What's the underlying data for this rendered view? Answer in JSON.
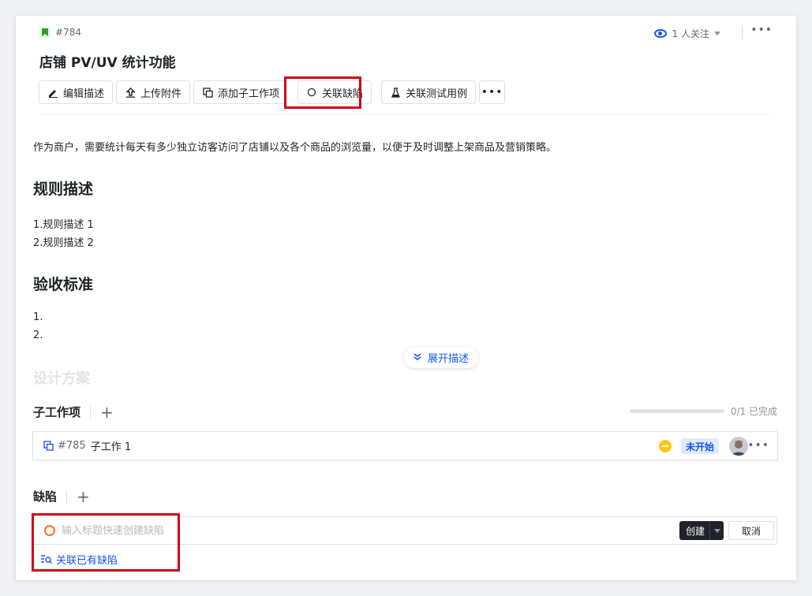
{
  "issue": {
    "id": "#784",
    "title": "店铺 PV/UV 统计功能",
    "followers": "1 人关注"
  },
  "toolbar": {
    "edit": "编辑描述",
    "upload": "上传附件",
    "add_child": "添加子工作项",
    "link_bug": "关联缺陷",
    "link_testcase": "关联测试用例"
  },
  "description": {
    "intro": "作为商户，需要统计每天有多少独立访客访问了店铺以及各个商品的浏览量，以便于及时调整上架商品及营销策略。",
    "rules_heading": "规则描述",
    "rules": [
      "1.规则描述 1",
      "2.规则描述 2"
    ],
    "acceptance_heading": "验收标准",
    "acceptance": [
      "1.",
      "2."
    ],
    "design_heading": "设计方案",
    "expand_label": "展开描述"
  },
  "subtasks": {
    "title": "子工作项",
    "progress_text": "0/1 已完成",
    "progress_fraction": 0,
    "items": [
      {
        "id": "#785",
        "name": "子工作 1",
        "status": "未开始"
      }
    ]
  },
  "bugs": {
    "title": "缺陷",
    "input_placeholder": "输入标题快速创建缺陷",
    "create_label": "创建",
    "cancel_label": "取消",
    "link_existing": "关联已有缺陷"
  },
  "colors": {
    "accent": "#1456f0",
    "highlight": "#d0021b",
    "priority": "#ffc60a",
    "bug_icon": "#f77234"
  }
}
